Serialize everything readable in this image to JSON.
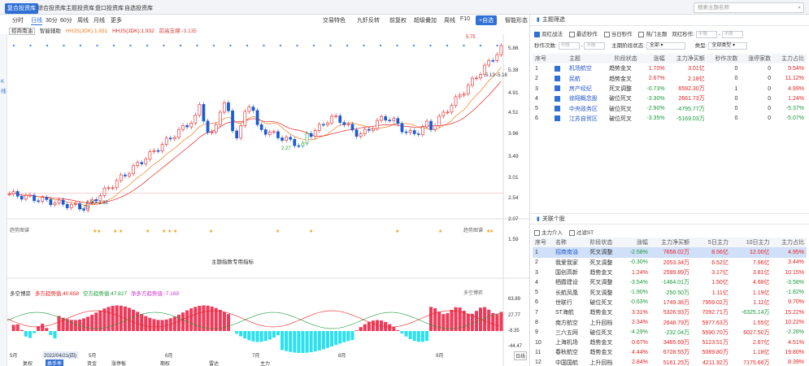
{
  "top_tabs": [
    "复合投资库",
    "综合投资库",
    "主题投资库",
    "盘口投资库",
    "自选投资库"
  ],
  "search_placeholder": "搜索主题名称",
  "period_tabs": [
    "分时",
    "日线",
    "30分",
    "60分",
    "周线",
    "月线",
    "更多"
  ],
  "toolbar_right": [
    "交易特色",
    "九虾反转",
    "前复权",
    "超级叠加",
    "周线",
    "F10"
  ],
  "add_fav": "+自选",
  "smart_label": "智能形态",
  "sidebar_letters": [
    "K",
    "线"
  ],
  "chart_title": "招商南油",
  "smart_assist": "智能辅助",
  "hhjs_legend": [
    "HHJS(JDK):1.931",
    "HHJS(JDK):1.932",
    "前高支撑:-3.135"
  ],
  "price_labels": [
    "5.86",
    "5.38",
    "4.91",
    "4.51",
    "3.96",
    "3.49",
    "3.01",
    "2.54",
    "2.07",
    "1.59"
  ],
  "current_price": "4.51",
  "annotations": {
    "high": "5.75",
    "range": "5.13~5.16",
    "low": "1.70",
    "low_range": "1.90~1.92",
    "mid": "2.27"
  },
  "panel2": {
    "left": "趋势图谱",
    "right": "趋势图谱",
    "center": "主题指数专用指标"
  },
  "panel3": {
    "title": "多空博弈",
    "a": "多方趋势值:40.658",
    "b": "空方趋势值:47.827",
    "c": "净多方趋势值:-7.169",
    "right": "多空博弈"
  },
  "panel3_ylabels": [
    "63.89",
    "27.77",
    "-8.35",
    "-44.47"
  ],
  "months": [
    "5月",
    "6月",
    "7月",
    "8月",
    "9月"
  ],
  "date_tag": "2022/04/21(四)",
  "weekly_label": "日线",
  "bottom_tabs": [
    "复权",
    "换手率",
    "资金",
    "涨停板",
    "期权",
    "雷达",
    "主力"
  ],
  "theme_filter": {
    "title": "主题筛选",
    "checks": [
      {
        "label": "双红战法",
        "on": true
      },
      {
        "label": "最近秒作",
        "on": false
      },
      {
        "label": "当日秒作",
        "on": false
      },
      {
        "label": "热门主题",
        "on": false
      }
    ],
    "label_dual": "双红秒作:",
    "ph_no": "不限",
    "row2_label": "秒作次数:",
    "stage_label": "主期阶段状态:",
    "stage_val": "全部",
    "type_label": "类型:",
    "type_val": "全部类型",
    "headers": [
      "序号",
      "",
      "主题",
      "阶段状态",
      "涨幅",
      "主力净买额",
      "秒作次数",
      "涨停家数",
      "主力占比"
    ],
    "rows": [
      [
        "1",
        "机场航空",
        "趋势金叉",
        "1.70%",
        "3.01亿",
        "0",
        "0",
        "9.54%"
      ],
      [
        "2",
        "民航",
        "趋势金叉",
        "2.67%",
        "2.18亿",
        "0",
        "0",
        "11.12%"
      ],
      [
        "3",
        "房产经纪",
        "死叉调整",
        "-0.73%",
        "6592.30万",
        "1",
        "0",
        "4.99%"
      ],
      [
        "4",
        "徐翔概念股",
        "破位死叉",
        "-3.30%",
        "2661.73万",
        "0",
        "0",
        "1.24%"
      ],
      [
        "5",
        "中央政务区",
        "破位死叉",
        "-2.90%",
        "-4795.77万",
        "0",
        "0",
        "-5.37%"
      ],
      [
        "6",
        "江苏自贸区",
        "破位死叉",
        "-3.35%",
        "-5169.03万",
        "0",
        "0",
        "-5.07%"
      ]
    ]
  },
  "related": {
    "title": "关联个股",
    "checks": [
      "主力介入",
      "过滤ST"
    ],
    "headers": [
      "序号",
      "名称",
      "阶段状态",
      "涨幅",
      "主力净买额",
      "5日主力",
      "10日主力",
      "主力占比"
    ],
    "rows": [
      [
        "1",
        "招商南油",
        "死叉调整",
        "-2.58%",
        "7658.02万",
        "8.56亿",
        "12.00亿",
        "4.95%"
      ],
      [
        "2",
        "我爱我家",
        "死叉调整",
        "-0.30%",
        "2053.34万",
        "6.52亿",
        "7.96亿",
        "3.44%"
      ],
      [
        "3",
        "国创高新",
        "趋势金叉",
        "1.24%",
        "2599.89万",
        "3.17亿",
        "3.81亿",
        "10.15%"
      ],
      [
        "4",
        "栖霞建设",
        "死叉调整",
        "-3.54%",
        "-1464.01万",
        "1.50亿",
        "4.68亿",
        "-3.58%"
      ],
      [
        "5",
        "长航凤凰",
        "死叉调整",
        "-1.90%",
        "-250.50万",
        "1.11亿",
        "1.19亿",
        "-1.82%"
      ],
      [
        "6",
        "世联行",
        "破位死叉",
        "-0.63%",
        "1749.38万",
        "7959.02万",
        "1.11亿",
        "9.70%"
      ],
      [
        "7",
        "ST海航",
        "趋势金叉",
        "3.31%",
        "5326.93万",
        "7092.71万",
        "-6325.14万",
        "15.22%"
      ],
      [
        "8",
        "南方航空",
        "上升回档",
        "2.34%",
        "2648.79万",
        "5977.63万",
        "1.55亿",
        "10.22%"
      ],
      [
        "9",
        "三六五网",
        "破位死叉",
        "-4.29%",
        "-232.04万",
        "5590.70万",
        "6027.50万",
        "-2.28%"
      ],
      [
        "10",
        "上海机场",
        "趋势金叉",
        "0.67%",
        "3485.69万",
        "5123.51万",
        "2.87亿",
        "4.51%"
      ],
      [
        "11",
        "春秋航空",
        "趋势金叉",
        "4.44%",
        "6728.55万",
        "5089.80万",
        "1.18亿",
        "19.80%"
      ],
      [
        "12",
        "中国国航",
        "上升回档",
        "2.84%",
        "5161.25万",
        "4211.92万",
        "7175.66万",
        "8.39%"
      ]
    ]
  }
}
